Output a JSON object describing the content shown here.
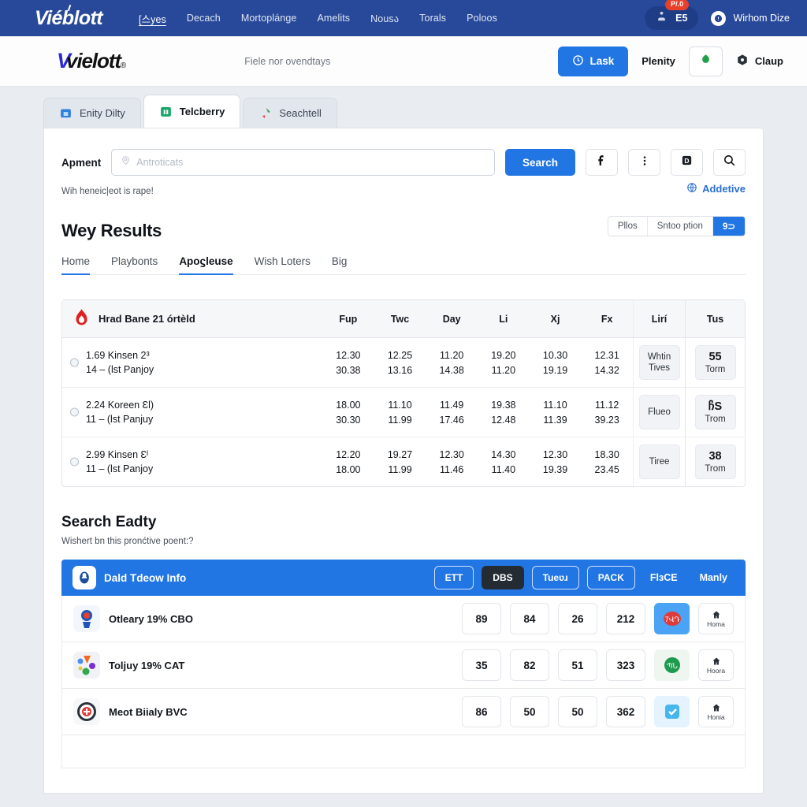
{
  "navbar": {
    "logo": "Viéblott",
    "links": [
      {
        "label": "[스yes",
        "active": true
      },
      {
        "label": "Decach",
        "active": false
      },
      {
        "label": "Mortoplánge",
        "active": false
      },
      {
        "label": "Amelits",
        "active": false
      },
      {
        "label": "Nousა",
        "active": false
      },
      {
        "label": "Torals",
        "active": false
      },
      {
        "label": "Poloos",
        "active": false
      }
    ],
    "pill": {
      "count": "E5",
      "badge": "P/.0"
    },
    "user": "Wirhom Dize"
  },
  "subheader": {
    "brand_mark": "V",
    "brand_word": "vielott",
    "brand_reg": "®",
    "note": "Fiele nor ovendtays",
    "primary_button": "Lask",
    "plenity": "Plenity",
    "claup": "Claup"
  },
  "tabs": [
    {
      "label": "Enity Dilty",
      "active": false,
      "icon": "briefcase-icon"
    },
    {
      "label": "Telcberry",
      "active": true,
      "icon": "calendar-icon"
    },
    {
      "label": "Seachtell",
      "active": false,
      "icon": "pin-icon"
    }
  ],
  "search": {
    "label": "Apment",
    "placeholder": "Antroticats",
    "value": "",
    "button": "Search",
    "hint": "Wih heneiᴄ|eot is rapeǃ",
    "addetive": "Addetive",
    "icons": [
      "facebook-icon",
      "more-vertical-icon",
      "dollar-box-icon",
      "search-icon"
    ]
  },
  "results": {
    "title": "Wey Results",
    "segment": [
      {
        "label": "Pllos",
        "on": false
      },
      {
        "label": "Sntoo ption",
        "on": false
      },
      {
        "label": "9⊃",
        "on": true
      }
    ],
    "subtabs": [
      {
        "label": "Home",
        "sel": false,
        "under": true
      },
      {
        "label": "Playbonts",
        "sel": false,
        "under": false
      },
      {
        "label": "Αpoϛleuse",
        "sel": true,
        "under": false
      },
      {
        "label": "Wish Loters",
        "sel": false,
        "under": false
      },
      {
        "label": "Big",
        "sel": false,
        "under": false
      }
    ]
  },
  "table": {
    "header": {
      "name": "Hrad Bane 21 órtèld",
      "columns": [
        "Fup",
        "Twc",
        "Day",
        "Li",
        "Xj",
        "Fx"
      ],
      "tag_col": "Lirí",
      "tus_col": "Tus"
    },
    "rows": [
      {
        "line1": "1.69 Kinsen 2³",
        "line2": "14 – (lst Panjoy",
        "top": [
          "12.30",
          "12.25",
          "11.20",
          "19.20",
          "10.30",
          "12.31"
        ],
        "bottom": [
          "30.38",
          "13.16",
          "14.38",
          "11.20",
          "19.19",
          "14.32"
        ],
        "tag_line1": "Whtin",
        "tag_line2": "Tives",
        "tus_big": "55",
        "tus_small": "Torm"
      },
      {
        "line1": "2.24 Koreen Ɛl)",
        "line2": "11 – (lst Panjuy",
        "top": [
          "18.00",
          "11.10",
          "11.49",
          "19.38",
          "11.10",
          "11.12"
        ],
        "bottom": [
          "30.30",
          "11.99",
          "17.46",
          "12.48",
          "11.39",
          "39.23"
        ],
        "tag_line1": "Flueo",
        "tag_line2": "",
        "tus_big": "ჩS",
        "tus_small": "Trom"
      },
      {
        "line1": "2.99 Kinsen Ɛᴵ",
        "line2": "11 – (lst Panjoy",
        "top": [
          "12.20",
          "19.27",
          "12.30",
          "14.30",
          "12.30",
          "18.30"
        ],
        "bottom": [
          "18.00",
          "11.99",
          "11.46",
          "11.40",
          "19.39",
          "23.45"
        ],
        "tag_line1": "Tiree",
        "tag_line2": "",
        "tus_big": "38",
        "tus_small": "Trom"
      }
    ]
  },
  "section2": {
    "title": "Search Eadty",
    "subtitle": "Wishert bn this pronćtive poent:?",
    "bluebar": {
      "title": "Dald Tdeow Info",
      "chips": [
        {
          "label": "ETT",
          "dark": false
        },
        {
          "label": "DBS",
          "dark": true
        },
        {
          "label": "Tueʋɹ",
          "dark": false
        },
        {
          "label": "PACK",
          "dark": false
        }
      ],
      "texts": [
        "FlɜCE",
        "Manly"
      ]
    },
    "rows": [
      {
        "name": "Otleary 19% CBO",
        "values": [
          "89",
          "84",
          "26",
          "212"
        ],
        "action_color": "#4ba3f5",
        "action_glyph": "7ՎԴ",
        "home_label": "Homa"
      },
      {
        "name": "Toljuy 19% CAT",
        "values": [
          "35",
          "82",
          "51",
          "323"
        ],
        "action_color": "#eef6ef",
        "action_glyph": "ՊՆ",
        "home_label": "Hoora"
      },
      {
        "name": "Meot Biialy ΒVC",
        "values": [
          "86",
          "50",
          "50",
          "362"
        ],
        "action_color": "#e4f3fd",
        "action_glyph": "✔",
        "home_label": "Honia"
      }
    ]
  },
  "colors": {
    "navbar": "#28499a",
    "accent": "#2276e3",
    "page_bg": "#e9edf2",
    "badge_red": "#e8402a"
  }
}
